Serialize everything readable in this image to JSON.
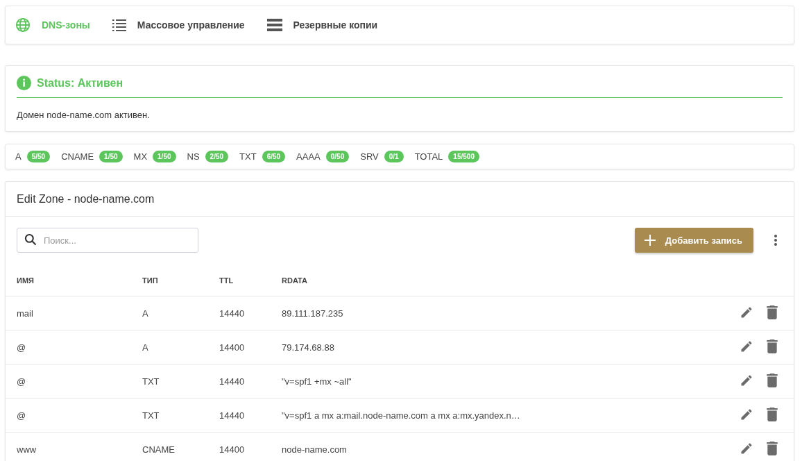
{
  "nav": [
    {
      "label": "DNS-зоны",
      "kind": "globe",
      "selected": true
    },
    {
      "label": "Массовое управление",
      "kind": "list",
      "selected": false
    },
    {
      "label": "Резервные копии",
      "kind": "server",
      "selected": false
    }
  ],
  "status": {
    "title": "Status: Активен",
    "message": "Домен node-name.com активен."
  },
  "counts": [
    {
      "type": "A",
      "usage": "5/50"
    },
    {
      "type": "CNAME",
      "usage": "1/50"
    },
    {
      "type": "MX",
      "usage": "1/50"
    },
    {
      "type": "NS",
      "usage": "2/50"
    },
    {
      "type": "TXT",
      "usage": "6/50"
    },
    {
      "type": "AAAA",
      "usage": "0/50"
    },
    {
      "type": "SRV",
      "usage": "0/1"
    },
    {
      "type": "TOTAL",
      "usage": "15/500"
    }
  ],
  "zone": {
    "title": "Edit Zone - node-name.com",
    "search": {
      "placeholder": "Поиск..."
    },
    "add_button": "Добавить запись",
    "columns": [
      "ИМЯ",
      "ТИП",
      "TTL",
      "RDATA"
    ],
    "rows": [
      [
        "mail",
        "A",
        "14440",
        "89.111.187.235"
      ],
      [
        "@",
        "A",
        "14400",
        "79.174.68.88"
      ],
      [
        "@",
        "TXT",
        "14440",
        "\"v=spf1 +mx ~all\""
      ],
      [
        "@",
        "TXT",
        "14440",
        "\"v=spf1 a mx a:mail.node-name.com a mx a:mx.yandex.n…"
      ],
      [
        "www",
        "CNAME",
        "14400",
        "node-name.com"
      ]
    ]
  }
}
